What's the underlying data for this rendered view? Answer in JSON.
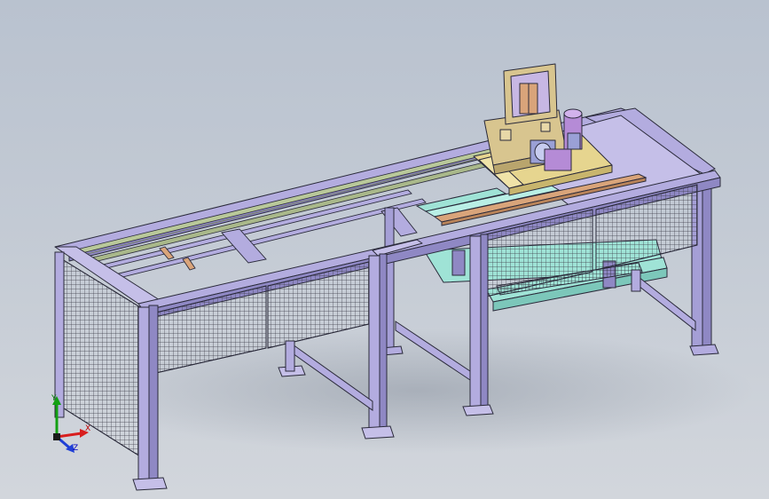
{
  "viewport": {
    "background_top": "#b9c2cf",
    "background_bottom": "#d2d6dc",
    "frame_color": "#b3acdf",
    "frame_outline": "#2a2a3a",
    "mesh_color": "#3b3b48",
    "rail_color": "#b9c89a",
    "carriage_color": "#d8c58f",
    "motor_color": "#b58bd6",
    "tray_color": "#9fe3d6",
    "plate_color": "#d9a47a"
  },
  "triad": {
    "x_label": "X",
    "y_label": "Y",
    "z_label": "Z",
    "x_color": "#d81e1e",
    "y_color": "#13a013",
    "z_color": "#1f3fd6"
  }
}
